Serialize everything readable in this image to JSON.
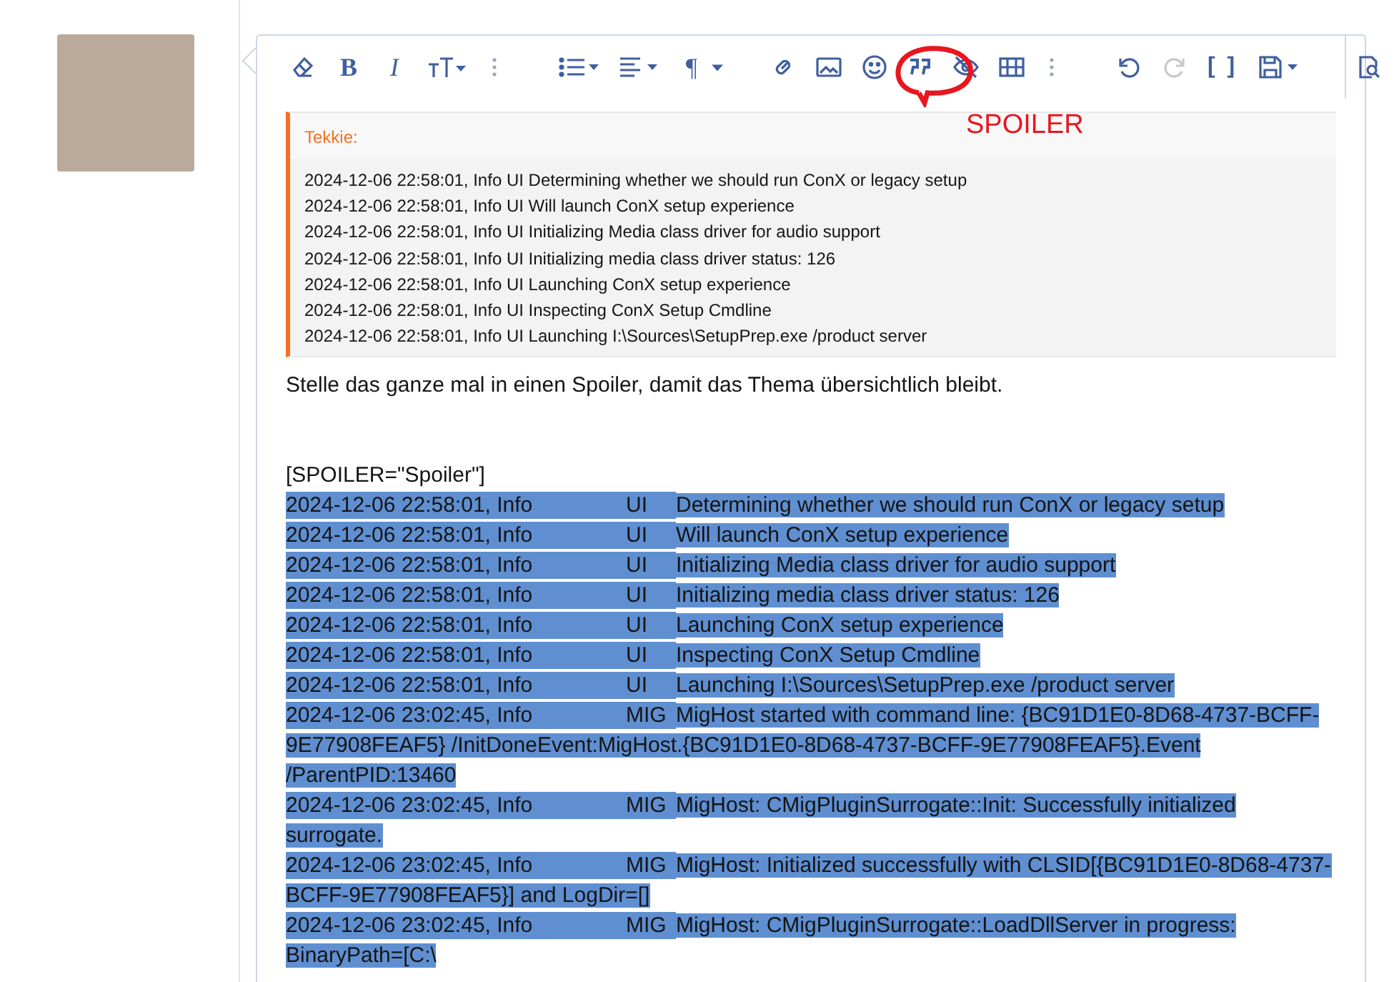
{
  "toolbar": {
    "bold": "B",
    "italic": "I",
    "paragraph": "¶",
    "brackets": "[ ]",
    "redo_disabled": true
  },
  "annotation": {
    "label": "SPOILER"
  },
  "quote": {
    "author": "Tekkie:",
    "lines": [
      "2024-12-06 22:58:01, Info UI Determining whether we should run ConX or legacy setup",
      "2024-12-06 22:58:01, Info UI Will launch ConX setup experience",
      "2024-12-06 22:58:01, Info UI Initializing Media class driver for audio support",
      "2024-12-06 22:58:01, Info UI Initializing media class driver status: 126",
      "2024-12-06 22:58:01, Info UI Launching ConX setup experience",
      "2024-12-06 22:58:01, Info UI Inspecting ConX Setup Cmdline",
      "2024-12-06 22:58:01, Info UI Launching I:\\Sources\\SetupPrep.exe /product server"
    ]
  },
  "editor": {
    "paragraph": "Stelle das ganze mal in einen Spoiler, damit das Thema übersichtlich bleibt.",
    "spoiler_tag": "[SPOILER=\"Spoiler\"]",
    "log_lines": [
      {
        "timestamp": "2024-12-06 22:58:01, Info",
        "source": "UI",
        "message": "Determining whether we should run ConX or legacy setup",
        "selected": true
      },
      {
        "timestamp": "2024-12-06 22:58:01, Info",
        "source": "UI",
        "message": "Will launch ConX setup experience",
        "selected": true
      },
      {
        "timestamp": "2024-12-06 22:58:01, Info",
        "source": "UI",
        "message": "Initializing Media class driver for audio support",
        "selected": true
      },
      {
        "timestamp": "2024-12-06 22:58:01, Info",
        "source": "UI",
        "message": "Initializing media class driver status: 126",
        "selected": true
      },
      {
        "timestamp": "2024-12-06 22:58:01, Info",
        "source": "UI",
        "message": "Launching ConX setup experience",
        "selected": true
      },
      {
        "timestamp": "2024-12-06 22:58:01, Info",
        "source": "UI",
        "message": "Inspecting ConX Setup Cmdline",
        "selected": true
      },
      {
        "timestamp": "2024-12-06 22:58:01, Info",
        "source": "UI",
        "message": "Launching I:\\Sources\\SetupPrep.exe /product server",
        "selected": true
      },
      {
        "timestamp": "2024-12-06 23:02:45, Info",
        "source": "MIG",
        "message": "MigHost started with command line: {BC91D1E0-8D68-4737-BCFF-9E77908FEAF5} /InitDoneEvent:MigHost.{BC91D1E0-8D68-4737-BCFF-9E77908FEAF5}.Event /ParentPID:13460",
        "selected": true
      },
      {
        "timestamp": "2024-12-06 23:02:45, Info",
        "source": "MIG",
        "message": "MigHost: CMigPluginSurrogate::Init: Successfully initialized surrogate.",
        "selected": true
      },
      {
        "timestamp": "2024-12-06 23:02:45, Info",
        "source": "MIG",
        "message": "MigHost: Initialized successfully with CLSID[{BC91D1E0-8D68-4737-BCFF-9E77908FEAF5}] and LogDir=[]",
        "selected": true
      },
      {
        "timestamp": "2024-12-06 23:02:45, Info",
        "source": "MIG",
        "message": "MigHost: CMigPluginSurrogate::LoadDllServer in progress: BinaryPath=[C:\\",
        "selected": true
      }
    ]
  }
}
